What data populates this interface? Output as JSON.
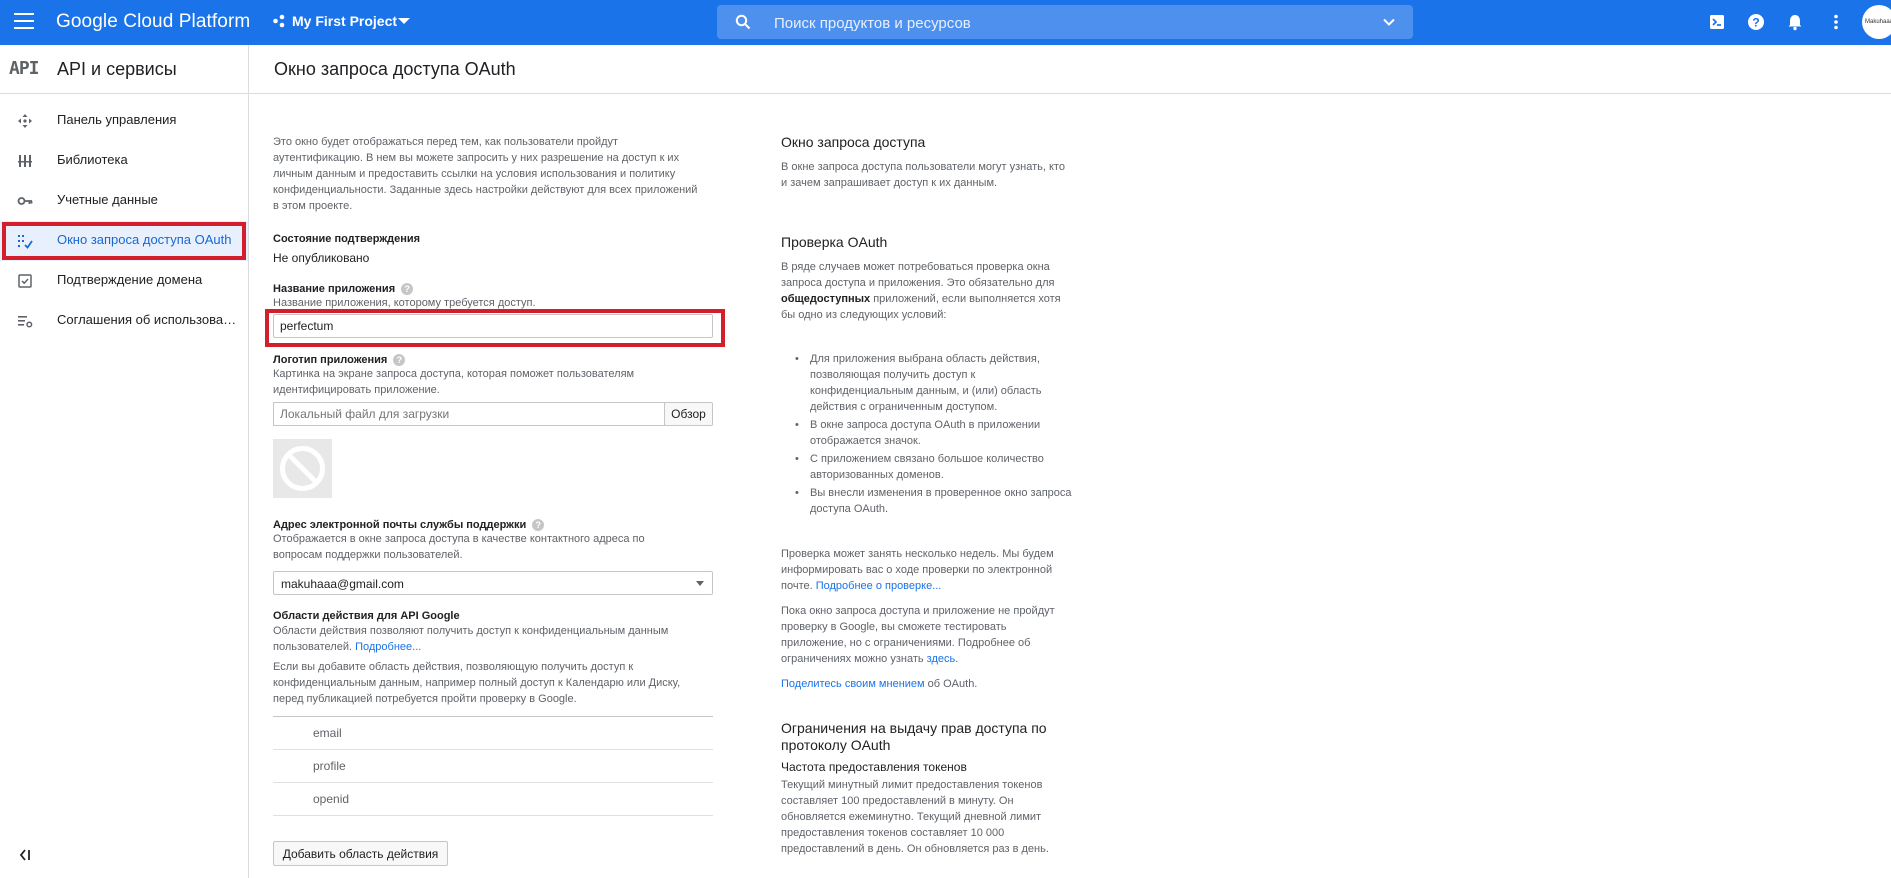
{
  "topbar": {
    "brand": "Google Cloud Platform",
    "project": "My First Project",
    "search_placeholder": "Поиск продуктов и ресурсов",
    "avatar_text": "Makuhaaa"
  },
  "sidebar": {
    "logo": "API",
    "title": "API и сервисы",
    "items": [
      {
        "label": "Панель управления",
        "icon": "dashboard-icon"
      },
      {
        "label": "Библиотека",
        "icon": "library-icon"
      },
      {
        "label": "Учетные данные",
        "icon": "key-icon"
      },
      {
        "label": "Окно запроса доступа OAuth",
        "icon": "consent-icon",
        "active": true
      },
      {
        "label": "Подтверждение домена",
        "icon": "checkbox-icon"
      },
      {
        "label": "Соглашения об использовании",
        "icon": "settings-list-icon"
      }
    ],
    "highlight_color": "#d31f2c"
  },
  "page": {
    "title": "Окно запроса доступа OAuth"
  },
  "form": {
    "intro": "Это окно будет отображаться перед тем, как пользователи пройдут аутентификацию. В нем вы можете запросить у них разрешение на доступ к их личным данным и предоставить ссылки на условия использования и политику конфиденциальности. Заданные здесь настройки действуют для всех приложений в этом проекте.",
    "status_label": "Состояние подтверждения",
    "status_value": "Не опубликовано",
    "app_name_label": "Название приложения",
    "app_name_hint": "Название приложения, которому требуется доступ.",
    "app_name_value": "perfectum",
    "logo_label": "Логотип приложения",
    "logo_hint": "Картинка на экране запроса доступа, которая поможет пользователям идентифицировать приложение.",
    "logo_placeholder": "Локальный файл для загрузки",
    "browse_button": "Обзор",
    "email_label": "Адрес электронной почты службы поддержки",
    "email_hint": "Отображается в окне запроса доступа в качестве контактного адреса по вопросам поддержки пользователей.",
    "email_value": "makuhaaa@gmail.com",
    "scopes_label": "Области действия для API Google",
    "scopes_hint": "Области действия позволяют получить доступ к конфиденциальным данным пользователей.",
    "scopes_more": "Подробнее...",
    "scopes_warning": "Если вы добавите область действия, позволяющую получить доступ к конфиденциальным данным, например полный доступ к Календарю или Диску, перед публикацией потребуется пройти проверку в Google.",
    "scopes": [
      "email",
      "profile",
      "openid"
    ],
    "add_scope_button": "Добавить область действия"
  },
  "info": {
    "h1": "Окно запроса доступа",
    "p1": "В окне запроса доступа пользователи могут узнать, кто и зачем запрашивает доступ к их данным.",
    "h2": "Проверка OAuth",
    "p2_a": "В ряде случаев может потребоваться проверка окна запроса доступа и приложения. Это обязательно для ",
    "p2_b": "общедоступных",
    "p2_c": " приложений, если выполняется хотя бы одно из следующих условий:",
    "bullets": [
      "Для приложения выбрана область действия, позволяющая получить доступ к конфиденциальным данным, и (или) область действия с ограниченным доступом.",
      "В окне запроса доступа OAuth в приложении отображается значок.",
      "С приложением связано большое количество авторизованных доменов.",
      "Вы внесли изменения в проверенное окно запроса доступа OAuth."
    ],
    "p3": "Проверка может занять несколько недель. Мы будем информировать вас о ходе проверки по электронной почте. ",
    "p3_link": "Подробнее о проверке...",
    "p4": "Пока окно запроса доступа и приложение не пройдут проверку в Google, вы сможете тестировать приложение, но с ограничениями. Подробнее об ограничениях можно узнать ",
    "p4_link": "здесь",
    "p4_end": ".",
    "p5_link": "Поделитесь своим мнением",
    "p5_text": " об OAuth.",
    "h3": "Ограничения на выдачу прав доступа по протоколу OAuth",
    "h4": "Частота предоставления токенов",
    "p6": "Текущий минутный лимит предоставления токенов составляет 100 предоставлений в минуту. Он обновляется ежеминутно. Текущий дневной лимит предоставления токенов составляет 10 000 предоставлений в день. Он обновляется раз в день."
  },
  "colors": {
    "primary": "#1a73e8",
    "highlight": "#d31f2c"
  }
}
